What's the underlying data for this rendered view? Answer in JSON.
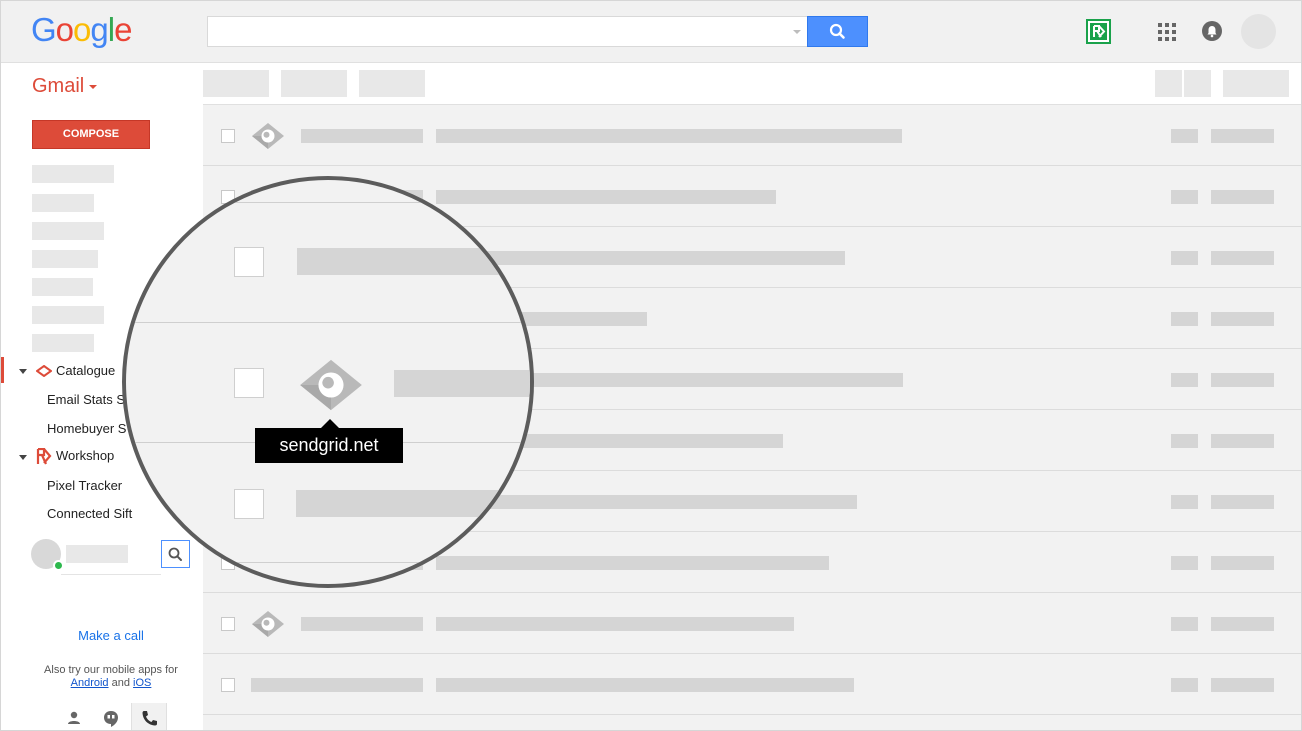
{
  "header": {
    "logo_letters": [
      "G",
      "o",
      "o",
      "g",
      "l",
      "e"
    ],
    "logo_colors": [
      "#4285f4",
      "#ea4335",
      "#fbbc05",
      "#4285f4",
      "#34a853",
      "#ea4335"
    ],
    "search_icon": "search-icon",
    "apps_icon": "apps-grid-icon",
    "notifications_icon": "notifications-bell-icon",
    "extension_icon": "rd-extension-icon"
  },
  "sidebar": {
    "app_switcher": "Gmail",
    "compose_label": "COMPOSE",
    "groups": [
      {
        "label": "Catalogue",
        "icon": "diamond-icon",
        "items": [
          "Email Stats S",
          "Homebuyer S"
        ]
      },
      {
        "label": "Workshop",
        "icon": "workshop-logo-icon",
        "items": [
          "Pixel Tracker",
          "Connected Sift"
        ]
      }
    ],
    "make_call": "Make a call",
    "mobile_note_prefix": "Also try our mobile apps for",
    "android_link": "Android",
    "and": "and",
    "ios_link": "iOS",
    "bottom_icons": [
      "person-icon",
      "hangouts-icon",
      "phone-icon"
    ],
    "accent": "#dd4b39"
  },
  "tooltip": {
    "text": "sendgrid.net"
  }
}
